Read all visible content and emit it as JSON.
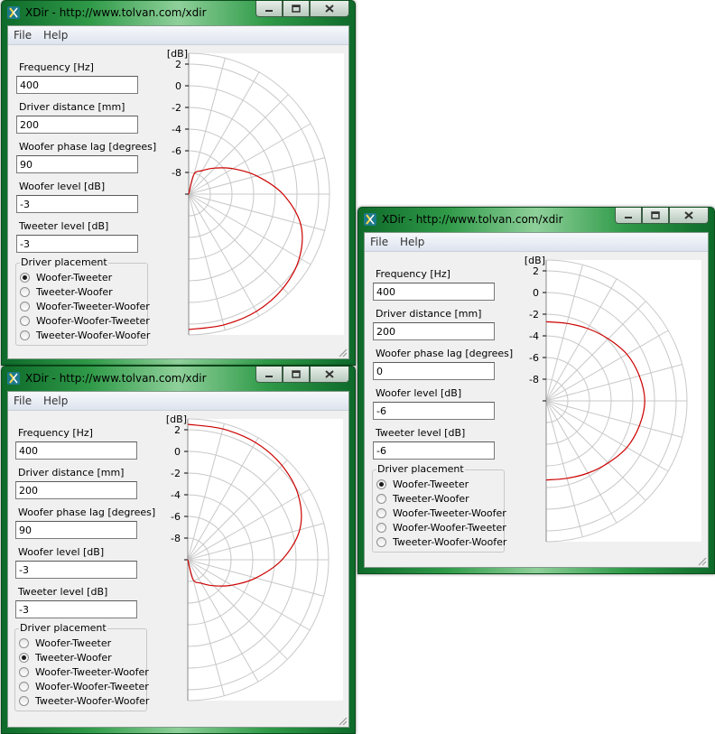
{
  "app": {
    "title": "XDir - http://www.tolvan.com/xdir",
    "menu": [
      "File",
      "Help"
    ],
    "field_labels": {
      "frequency": "Frequency [Hz]",
      "distance": "Driver distance [mm]",
      "phase": "Woofer phase lag [degrees]",
      "woofer_level": "Woofer level [dB]",
      "tweeter_level": "Tweeter level [dB]"
    },
    "placement_title": "Driver placement",
    "placement_options": [
      "Woofer-Tweeter",
      "Tweeter-Woofer",
      "Woofer-Tweeter-Woofer",
      "Woofer-Woofer-Tweeter",
      "Tweeter-Woofer-Woofer"
    ],
    "colors": {
      "curve": "#cc0000",
      "grid": "#c8c8c8",
      "axis": "#888888",
      "plot_bg": "#ffffff",
      "frame_bg": "#f0f0f0",
      "titlebar": "#2f9a48"
    },
    "icons": {
      "app": "xdir-app-icon",
      "minimize": "minimize-icon",
      "maximize": "maximize-icon",
      "close": "close-icon",
      "grip": "resize-grip-icon"
    }
  },
  "windows": [
    {
      "frequency": "400",
      "distance": "200",
      "phase": "90",
      "woofer_level": "-3",
      "tweeter_level": "-3",
      "selected_placement": 0
    },
    {
      "frequency": "400",
      "distance": "200",
      "phase": "90",
      "woofer_level": "-3",
      "tweeter_level": "-3",
      "selected_placement": 1
    },
    {
      "frequency": "400",
      "distance": "200",
      "phase": "0",
      "woofer_level": "-6",
      "tweeter_level": "-6",
      "selected_placement": 0
    }
  ],
  "chart_data": [
    {
      "type": "line",
      "subtype": "polar-half",
      "unit_label": "[dB]",
      "r_ticks": [
        2,
        0,
        -2,
        -4,
        -6,
        -8
      ],
      "r_range": [
        -10,
        3
      ],
      "angle_range_deg": [
        -90,
        90
      ],
      "spoke_step_deg": 15,
      "grid": true,
      "series": [
        {
          "angle_deg": [
            90,
            75,
            60,
            45,
            30,
            15,
            0,
            -15,
            -30,
            -45,
            -60,
            -75,
            -90
          ],
          "db": [
            -10,
            -8.1,
            -7.5,
            -6.6,
            -5.3,
            -3.5,
            -1.3,
            0.7,
            1.8,
            2.3,
            2.5,
            2.5,
            2.5
          ]
        }
      ]
    },
    {
      "type": "line",
      "subtype": "polar-half",
      "unit_label": "[dB]",
      "r_ticks": [
        2,
        0,
        -2,
        -4,
        -6,
        -8
      ],
      "r_range": [
        -10,
        3
      ],
      "angle_range_deg": [
        -90,
        90
      ],
      "spoke_step_deg": 15,
      "grid": true,
      "series": [
        {
          "angle_deg": [
            90,
            75,
            60,
            45,
            30,
            15,
            0,
            -15,
            -30,
            -45,
            -60,
            -75,
            -90
          ],
          "db": [
            2.5,
            2.5,
            2.5,
            2.3,
            1.8,
            0.7,
            -1.3,
            -3.5,
            -5.3,
            -6.6,
            -7.5,
            -8.1,
            -10
          ]
        }
      ]
    },
    {
      "type": "line",
      "subtype": "polar-half",
      "unit_label": "[dB]",
      "r_ticks": [
        2,
        0,
        -2,
        -4,
        -6,
        -8
      ],
      "r_range": [
        -10,
        3
      ],
      "angle_range_deg": [
        -90,
        90
      ],
      "spoke_step_deg": 15,
      "grid": true,
      "series": [
        {
          "angle_deg": [
            90,
            75,
            60,
            45,
            30,
            15,
            0,
            -15,
            -30,
            -45,
            -60,
            -75,
            -90
          ],
          "db": [
            -2.7,
            -2.6,
            -2.3,
            -1.9,
            -1.4,
            -1.1,
            -0.9,
            -1.1,
            -1.4,
            -1.9,
            -2.3,
            -2.6,
            -2.7
          ]
        }
      ]
    }
  ]
}
